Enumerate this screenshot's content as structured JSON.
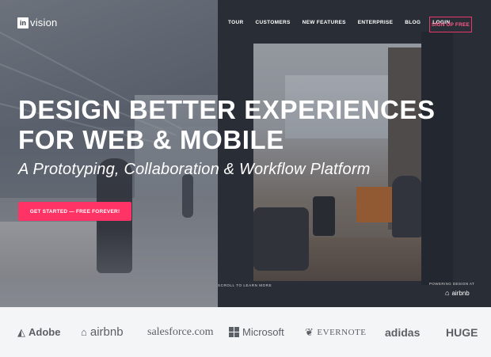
{
  "header": {
    "logo_box": "in",
    "logo_text": "vision",
    "nav": [
      "TOUR",
      "CUSTOMERS",
      "NEW FEATURES",
      "ENTERPRISE",
      "BLOG",
      "LOGIN"
    ],
    "signup_label": "SIGN UP FREE"
  },
  "hero": {
    "headline_line1": "DESIGN BETTER EXPERIENCES",
    "headline_line2": "FOR WEB & MOBILE",
    "subheadline": "A Prototyping, Collaboration & Workflow Platform",
    "cta_label": "GET STARTED — FREE FOREVER!",
    "scroll_hint": "SCROLL TO LEARN MORE",
    "powering_label": "POWERING DESIGN AT",
    "powering_brand": "airbnb"
  },
  "logos": {
    "adobe": "Adobe",
    "airbnb": "airbnb",
    "salesforce": "salesforce.com",
    "microsoft": "Microsoft",
    "evernote": "EVERNOTE",
    "adidas": "adidas",
    "huge": "HUGE"
  },
  "colors": {
    "accent": "#ff3366",
    "signup_border": "#e8386d",
    "logos_bg": "#f4f5f6"
  }
}
